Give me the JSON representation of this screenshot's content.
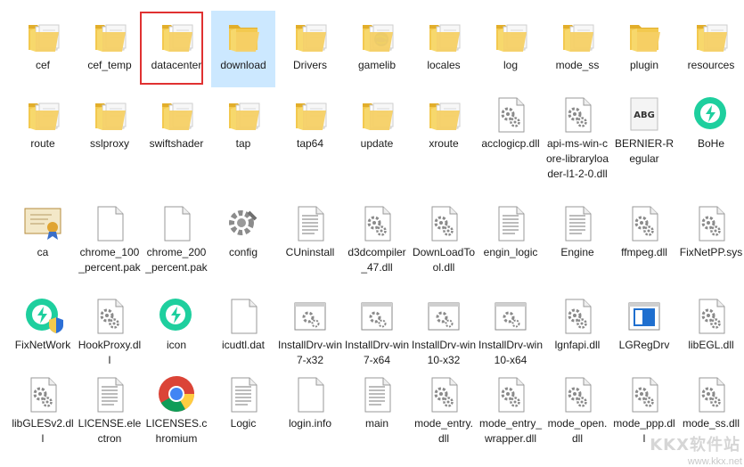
{
  "items": [
    {
      "label": "cef",
      "type": "folder"
    },
    {
      "label": "cef_temp",
      "type": "folder"
    },
    {
      "label": "datacenter",
      "type": "folder"
    },
    {
      "label": "download",
      "type": "folder-plain",
      "selected": true
    },
    {
      "label": "Drivers",
      "type": "folder"
    },
    {
      "label": "gamelib",
      "type": "folder-globe"
    },
    {
      "label": "locales",
      "type": "folder"
    },
    {
      "label": "log",
      "type": "folder"
    },
    {
      "label": "mode_ss",
      "type": "folder"
    },
    {
      "label": "plugin",
      "type": "folder-plain"
    },
    {
      "label": "resources",
      "type": "folder"
    },
    {
      "label": "route",
      "type": "folder"
    },
    {
      "label": "sslproxy",
      "type": "folder"
    },
    {
      "label": "swiftshader",
      "type": "folder"
    },
    {
      "label": "tap",
      "type": "folder"
    },
    {
      "label": "tap64",
      "type": "folder"
    },
    {
      "label": "update",
      "type": "folder"
    },
    {
      "label": "xroute",
      "type": "folder"
    },
    {
      "label": "acclogicp.dll",
      "type": "dll"
    },
    {
      "label": "api-ms-win-core-libraryloader-l1-2-0.dll",
      "type": "dll"
    },
    {
      "label": "BERNIER-Regular",
      "type": "font",
      "glyph": "ABG"
    },
    {
      "label": "BoHe",
      "type": "app-bohe"
    },
    {
      "label": "ca",
      "type": "cert"
    },
    {
      "label": "chrome_100_percent.pak",
      "type": "file"
    },
    {
      "label": "chrome_200_percent.pak",
      "type": "file"
    },
    {
      "label": "config",
      "type": "config"
    },
    {
      "label": "CUninstall",
      "type": "text"
    },
    {
      "label": "d3dcompiler_47.dll",
      "type": "dll"
    },
    {
      "label": "DownLoadTool.dll",
      "type": "dll"
    },
    {
      "label": "engin_logic",
      "type": "text"
    },
    {
      "label": "Engine",
      "type": "text"
    },
    {
      "label": "ffmpeg.dll",
      "type": "dll"
    },
    {
      "label": "FixNetPP.sys",
      "type": "dll"
    },
    {
      "label": "FixNetWork",
      "type": "app-shield"
    },
    {
      "label": "HookProxy.dll",
      "type": "dll"
    },
    {
      "label": "icon",
      "type": "app-bohe"
    },
    {
      "label": "icudtl.dat",
      "type": "file"
    },
    {
      "label": "InstallDrv-win7-x32",
      "type": "window-gear"
    },
    {
      "label": "InstallDrv-win7-x64",
      "type": "window-gear"
    },
    {
      "label": "InstallDrv-win10-x32",
      "type": "window-gear"
    },
    {
      "label": "InstallDrv-win10-x64",
      "type": "window-gear"
    },
    {
      "label": "lgnfapi.dll",
      "type": "dll"
    },
    {
      "label": "LGRegDrv",
      "type": "window-blue"
    },
    {
      "label": "libEGL.dll",
      "type": "dll"
    },
    {
      "label": "libGLESv2.dll",
      "type": "dll"
    },
    {
      "label": "LICENSE.electron",
      "type": "text"
    },
    {
      "label": "LICENSES.chromium",
      "type": "chrome"
    },
    {
      "label": "Logic",
      "type": "text"
    },
    {
      "label": "login.info",
      "type": "file"
    },
    {
      "label": "main",
      "type": "text"
    },
    {
      "label": "mode_entry.dll",
      "type": "dll"
    },
    {
      "label": "mode_entry_wrapper.dll",
      "type": "dll"
    },
    {
      "label": "mode_open.dll",
      "type": "dll"
    },
    {
      "label": "mode_ppp.dll",
      "type": "dll"
    },
    {
      "label": "mode_ss.dll",
      "type": "dll"
    }
  ],
  "watermark": {
    "logo": "KKX软件站",
    "url": "www.kkx.net"
  },
  "colors": {
    "folder": "#f3c94f",
    "folderDark": "#e2ae2a",
    "select": "#cce8ff",
    "annot": "#e03131"
  }
}
